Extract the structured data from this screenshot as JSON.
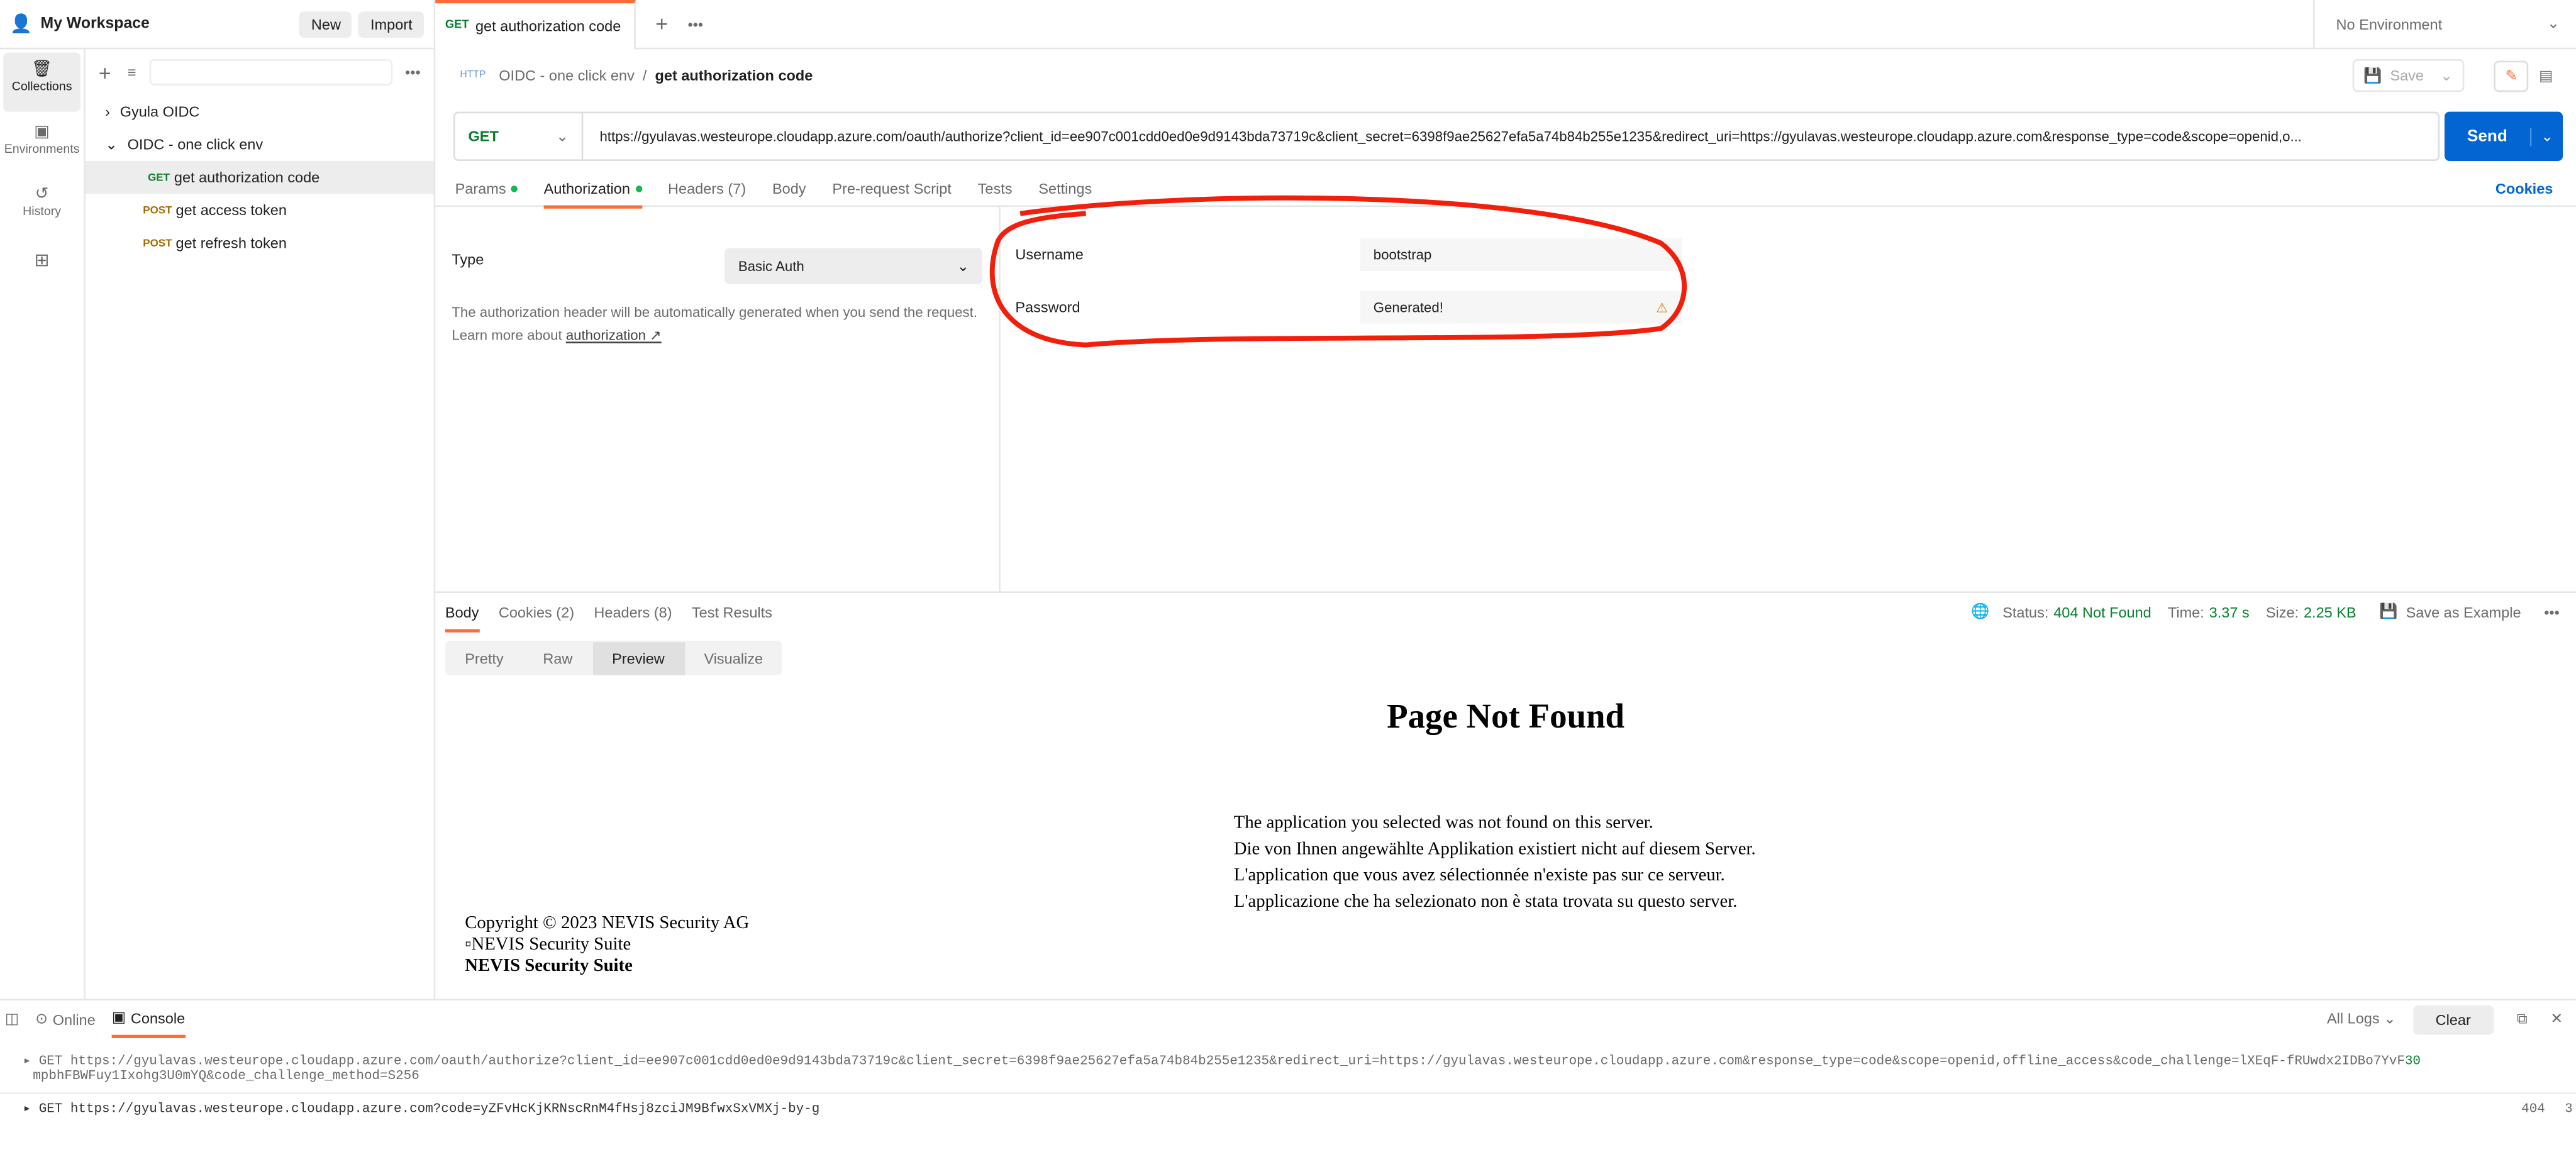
{
  "workspace": {
    "title": "My Workspace",
    "new_label": "New",
    "import_label": "Import"
  },
  "tabs": [
    {
      "method": "GET",
      "label": "get authorization code"
    }
  ],
  "environment": "No Environment",
  "rail": [
    {
      "label": "Collections",
      "icon": "collections-icon"
    },
    {
      "label": "Environments",
      "icon": "environments-icon"
    },
    {
      "label": "History",
      "icon": "history-icon"
    },
    {
      "label": "",
      "icon": "add-apps-icon"
    }
  ],
  "collections": [
    {
      "label": "Gyula OIDC",
      "expanded": false
    },
    {
      "label": "OIDC - one click env",
      "expanded": true,
      "requests": [
        {
          "method": "GET",
          "label": "get authorization code"
        },
        {
          "method": "POST",
          "label": "get access token"
        },
        {
          "method": "POST",
          "label": "get refresh token"
        }
      ]
    }
  ],
  "breadcrumb": {
    "collection": "OIDC - one click env",
    "sep": "/",
    "request": "get authorization code"
  },
  "save_label": "Save",
  "request": {
    "method": "GET",
    "url": "https://gyulavas.westeurope.cloudapp.azure.com/oauth/authorize?client_id=ee907c001cdd0ed0e9d9143bda73719c&client_secret=6398f9ae25627efa5a74b84b255e1235&redirect_uri=https://gyulavas.westeurope.cloudapp.azure.com&response_type=code&scope=openid,o...",
    "send_label": "Send"
  },
  "req_tabs": [
    "Params",
    "Authorization",
    "Headers (7)",
    "Body",
    "Pre-request Script",
    "Tests",
    "Settings"
  ],
  "cookies_label": "Cookies",
  "auth": {
    "type_label": "Type",
    "type_value": "Basic Auth",
    "help": "The authorization header will be automatically generated when you send the request. Learn more about ",
    "help_link": "authorization ↗",
    "username_label": "Username",
    "username": "bootstrap",
    "password_label": "Password",
    "password": "Generated!"
  },
  "resp_tabs": [
    "Body",
    "Cookies (2)",
    "Headers (8)",
    "Test Results"
  ],
  "status": {
    "status_label": "Status:",
    "status": "404 Not Found",
    "time_label": "Time:",
    "time": "3.37 s",
    "size_label": "Size:",
    "size": "2.25 KB",
    "save_example": "Save as Example"
  },
  "view_modes": [
    "Pretty",
    "Raw",
    "Preview",
    "Visualize"
  ],
  "preview": {
    "title": "Page Not Found",
    "lines": [
      "The application you selected was not found on this server.",
      "Die von Ihnen angewählte Applikation existiert nicht auf diesem Server.",
      "L'application que vous avez sélectionnée n'existe pas sur ce serveur.",
      "L'applicazione che ha selezionato non è stata trovata su questo server."
    ],
    "copyright": "Copyright © 2023 NEVIS Security AG",
    "img_alt": "NEVIS Security Suite",
    "brand": "NEVIS Security Suite"
  },
  "footer": {
    "online": "Online",
    "console": "Console",
    "all_logs": "All Logs",
    "clear": "Clear"
  },
  "logs": [
    {
      "text": "GET https://gyulavas.westeurope.cloudapp.azure.com/oauth/authorize?client_id=ee907c001cdd0ed0e9d9143bda73719c&client_secret=6398f9ae25627efa5a74b84b255e1235&redirect_uri=https://gyulavas.westeurope.cloudapp.azure.com&response_type=code&scope=openid,offline_access&code_challenge=lXEqF-fRUwdx2IDBo7YvF",
      "text2": "mpbhFBWFuy1Ixohg3U0mYQ&code_challenge_method=S256",
      "status": "30"
    },
    {
      "text": "GET https://gyulavas.westeurope.cloudapp.azure.com?code=yZFvHcKjKRNscRnM4fHsj8zciJM9BfwxSxVMXj-by-g",
      "status": "404",
      "time": "3"
    }
  ]
}
